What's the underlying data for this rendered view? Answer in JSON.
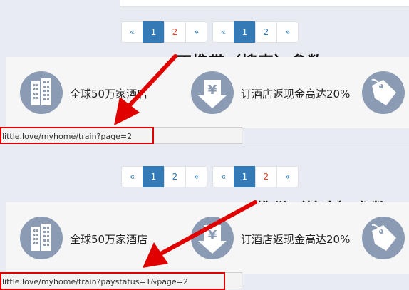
{
  "pagination_a": {
    "prev": "«",
    "pages": [
      "1",
      "2"
    ],
    "next": "»",
    "active": "1"
  },
  "pagination_b": {
    "prev": "«",
    "pages": [
      "1",
      "2"
    ],
    "next": "»",
    "active": "1"
  },
  "top": {
    "annotation": "不携带（搜索）参数",
    "url": "little.love/myhome/train?page=2"
  },
  "bottom": {
    "annotation": "携带（搜索）参数",
    "url": "little.love/myhome/train?paystatus=1&page=2"
  },
  "features": [
    {
      "icon": "building-icon",
      "text": "全球50万家酒店"
    },
    {
      "icon": "yen-icon",
      "text": "订酒店返现金高达20%"
    },
    {
      "icon": "price-tag-icon",
      "text": ""
    }
  ],
  "colors": {
    "active_page": "#337ab7",
    "highlight": "#e8452c",
    "icon_circle": "#8a9bb3",
    "annotation_red": "#e00000"
  }
}
